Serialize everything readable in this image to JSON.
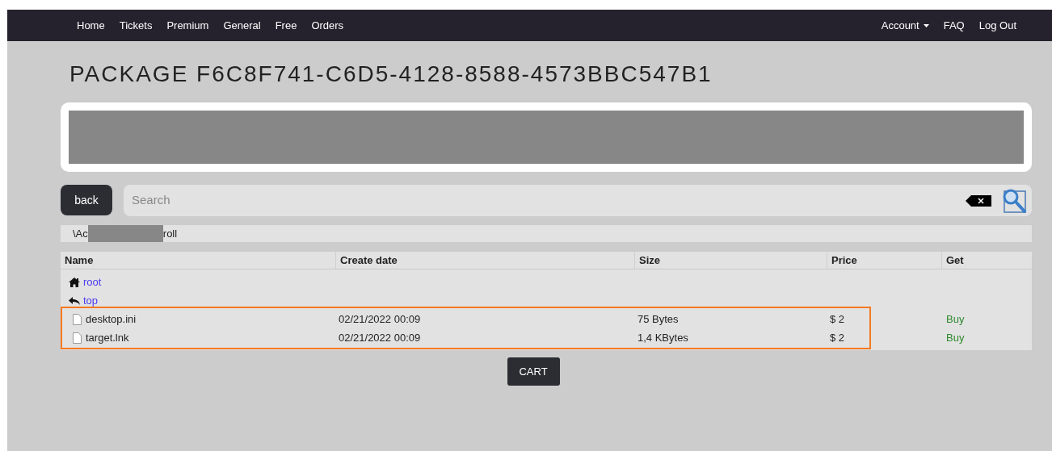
{
  "nav": {
    "left": [
      "Home",
      "Tickets",
      "Premium",
      "General",
      "Free",
      "Orders"
    ],
    "account": "Account",
    "right": [
      "FAQ",
      "Log Out"
    ]
  },
  "title": "PACKAGE F6C8F741-C6D5-4128-8588-4573BBC547B1",
  "back_button": "back",
  "search": {
    "placeholder": "Search"
  },
  "path": {
    "before": "\\Ac",
    "after": "roll"
  },
  "table": {
    "columns": [
      "Name",
      "Create date",
      "Size",
      "Price",
      "Get"
    ],
    "links": [
      {
        "kind": "home",
        "label": "root"
      },
      {
        "kind": "up",
        "label": "top"
      }
    ],
    "rows": [
      {
        "name": "desktop.ini",
        "date": "02/21/2022 00:09",
        "size": "75 Bytes",
        "price": "$ 2",
        "get": "Buy"
      },
      {
        "name": "target.lnk",
        "date": "02/21/2022 00:09",
        "size": "1,4 KBytes",
        "price": "$ 2",
        "get": "Buy"
      }
    ]
  },
  "cart_button": "CART"
}
